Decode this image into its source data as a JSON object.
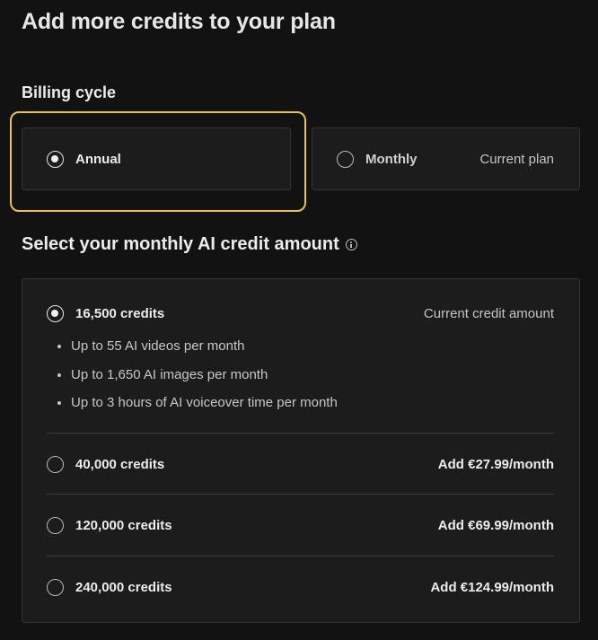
{
  "header": {
    "title": "Add more credits to your plan"
  },
  "billing": {
    "label": "Billing cycle",
    "options": [
      {
        "label": "Annual",
        "selected": true,
        "note": ""
      },
      {
        "label": "Monthly",
        "selected": false,
        "note": "Current plan"
      }
    ]
  },
  "credits": {
    "title": "Select your monthly AI credit amount",
    "options": [
      {
        "label": "16,500 credits",
        "selected": true,
        "note": "Current credit amount",
        "features": [
          "Up to 55 AI videos per month",
          "Up to 1,650 AI images per month",
          "Up to 3 hours of AI voiceover time per month"
        ]
      },
      {
        "label": "40,000 credits",
        "selected": false,
        "price": "Add €27.99/month"
      },
      {
        "label": "120,000 credits",
        "selected": false,
        "price": "Add €69.99/month"
      },
      {
        "label": "240,000 credits",
        "selected": false,
        "price": "Add €124.99/month"
      }
    ]
  },
  "colors": {
    "background": "#121212",
    "card": "#1c1c1c",
    "highlight": "#e8c24a"
  }
}
